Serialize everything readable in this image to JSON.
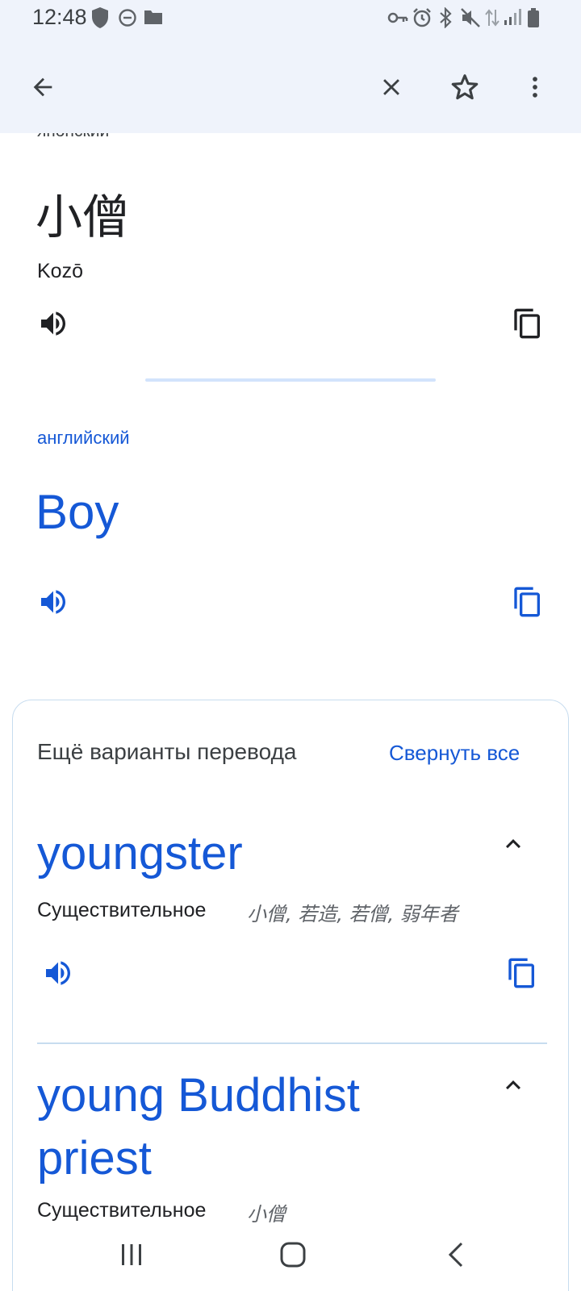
{
  "status_bar": {
    "time": "12:48",
    "left_icons": [
      "shield-icon",
      "do-not-disturb-icon",
      "folder-icon"
    ],
    "right_icons": [
      "vpn-key-icon",
      "alarm-icon",
      "bluetooth-icon",
      "mute-icon",
      "data-arrows-icon",
      "signal-icon",
      "battery-icon"
    ]
  },
  "toolbar": {
    "back_icon": "arrow-back-icon",
    "close_icon": "close-icon",
    "star_icon": "star-outline-icon",
    "more_icon": "more-vert-icon"
  },
  "source": {
    "language": "японский",
    "text": "小僧",
    "romanization": "Kozō"
  },
  "target": {
    "language": "английский",
    "text": "Boy"
  },
  "more_translations": {
    "title": "Ещё варианты перевода",
    "collapse_all": "Свернуть все",
    "items": [
      {
        "word": "youngster",
        "part_of_speech": "Существительное",
        "synonyms": "小僧, 若造, 若僧, 弱年者"
      },
      {
        "word_line1": "young Buddhist",
        "word_line2": "priest",
        "part_of_speech": "Существительное",
        "synonyms": "小僧"
      }
    ]
  },
  "colors": {
    "accent": "#1558d6",
    "header_bg": "#eff3fb",
    "divider": "#c7dcef"
  }
}
